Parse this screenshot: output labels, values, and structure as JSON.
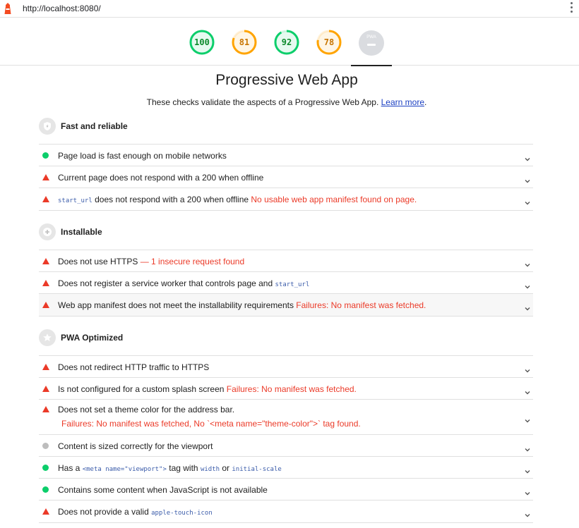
{
  "browser": {
    "url": "http://localhost:8080/",
    "logo_icon": "lighthouse-icon"
  },
  "colors": {
    "pass": "#0cce6b",
    "average": "#ffa400",
    "fail": "#eb3a28",
    "link": "#1a3fc2"
  },
  "gauges": [
    {
      "value": "100",
      "status": "pass",
      "fraction": 1.0
    },
    {
      "value": "81",
      "status": "average",
      "fraction": 0.81
    },
    {
      "value": "92",
      "status": "pass",
      "fraction": 0.92
    },
    {
      "value": "78",
      "status": "average",
      "fraction": 0.78
    }
  ],
  "pwa_badge": {
    "label": "PWA",
    "score": "–"
  },
  "section": {
    "title": "Progressive Web App",
    "description": "These checks validate the aspects of a Progressive Web App.",
    "learn_more": "Learn more",
    "trailing": "."
  },
  "groups": [
    {
      "title": "Fast and reliable",
      "icon": "lightning-shield-icon",
      "audits": [
        {
          "status": "pass",
          "parts": [
            {
              "t": "Page load is fast enough on mobile networks"
            }
          ]
        },
        {
          "status": "fail",
          "parts": [
            {
              "t": "Current page does not respond with a 200 when offline"
            }
          ]
        },
        {
          "status": "fail",
          "parts": [
            {
              "t": "start_url",
              "k": "code"
            },
            {
              "t": " does not respond with a 200 when offline "
            },
            {
              "t": "No usable web app manifest found on page.",
              "k": "err"
            }
          ]
        }
      ]
    },
    {
      "title": "Installable",
      "icon": "plus-circle-icon",
      "audits": [
        {
          "status": "fail",
          "parts": [
            {
              "t": "Does not use HTTPS "
            },
            {
              "t": " — 1 insecure request found",
              "k": "err"
            }
          ]
        },
        {
          "status": "fail",
          "parts": [
            {
              "t": "Does not register a service worker that controls page and "
            },
            {
              "t": "start_url",
              "k": "code"
            }
          ]
        },
        {
          "status": "fail",
          "parts": [
            {
              "t": "Web app manifest does not meet the installability requirements "
            },
            {
              "t": "Failures: No manifest was fetched.",
              "k": "err"
            }
          ],
          "highlight": true
        }
      ]
    },
    {
      "title": "PWA Optimized",
      "icon": "star-icon",
      "audits": [
        {
          "status": "fail",
          "parts": [
            {
              "t": "Does not redirect HTTP traffic to HTTPS"
            }
          ]
        },
        {
          "status": "fail",
          "parts": [
            {
              "t": "Is not configured for a custom splash screen "
            },
            {
              "t": "Failures: No manifest was fetched.",
              "k": "err"
            }
          ]
        },
        {
          "status": "fail",
          "parts": [
            {
              "t": "Does not set a theme color for the address bar."
            }
          ],
          "sub": "Failures: No manifest was fetched, No `<meta name=\"theme-color\">` tag found."
        },
        {
          "status": "manual",
          "parts": [
            {
              "t": "Content is sized correctly for the viewport"
            }
          ]
        },
        {
          "status": "pass",
          "parts": [
            {
              "t": "Has a "
            },
            {
              "t": "<meta name=\"viewport\">",
              "k": "code"
            },
            {
              "t": " tag with "
            },
            {
              "t": "width",
              "k": "code"
            },
            {
              "t": " or "
            },
            {
              "t": "initial-scale",
              "k": "code"
            }
          ]
        },
        {
          "status": "pass",
          "parts": [
            {
              "t": "Contains some content when JavaScript is not available"
            }
          ]
        },
        {
          "status": "fail",
          "parts": [
            {
              "t": "Does not provide a valid "
            },
            {
              "t": "apple-touch-icon",
              "k": "code"
            }
          ]
        }
      ]
    }
  ]
}
